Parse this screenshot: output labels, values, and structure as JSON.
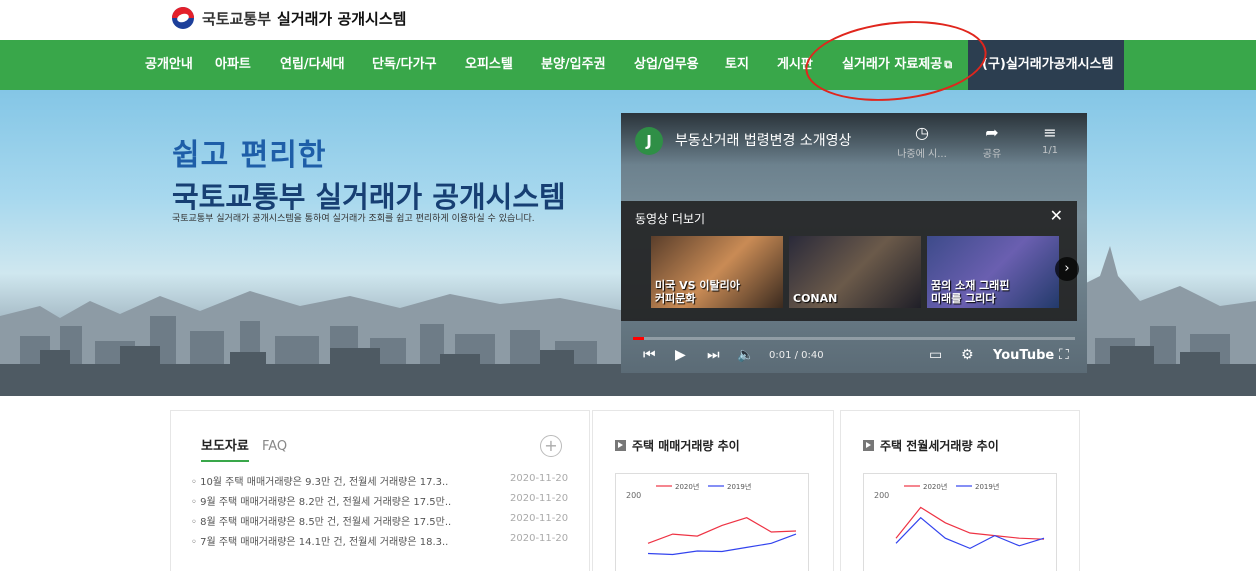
{
  "header": {
    "org_name": "국토교통부",
    "system_name": "실거래가 공개시스템"
  },
  "nav": {
    "items": [
      "공개안내",
      "아파트",
      "연립/다세대",
      "단독/다가구",
      "오피스텔",
      "분양/입주권",
      "상업/업무용",
      "토지",
      "게시판",
      "실거래가 자료제공"
    ],
    "old_system": "(구)실거래가공개시스템"
  },
  "banner": {
    "line1": "쉽고 편리한",
    "line2": "국토교통부 실거래가 공개시스템",
    "description": "국토교통부 실거래가 공개시스템을 통하여 실거래가 조회를 쉽고 편리하게 이용하실 수 있습니다."
  },
  "video": {
    "channel_initial": "J",
    "title": "부동산거래 법령변경 소개영상",
    "watch_later": "나중에 시...",
    "share": "공유",
    "playlist_count": "1/1",
    "more_videos": "동영상 더보기",
    "thumbs": [
      {
        "caption_line1": "미국 VS 이탈리아",
        "caption_line2": "커피문화"
      },
      {
        "caption_line1": "",
        "caption_line2": "CONAN"
      },
      {
        "caption_line1": "꿈의 소재 그래핀",
        "caption_line2": "미래를 그리다"
      }
    ],
    "time": "0:01 / 0:40",
    "progress": 0.025,
    "brand": "YouTube"
  },
  "news": {
    "tab_active": "보도자료",
    "tab_inactive": "FAQ",
    "items": [
      {
        "title": "10월 주택 매매거래량은 9.3만 건, 전월세 거래량은 17.3..",
        "date": "2020-11-20"
      },
      {
        "title": "9월 주택 매매거래량은 8.2만 건, 전월세 거래량은 17.5만..",
        "date": "2020-11-20"
      },
      {
        "title": "8월 주택 매매거래량은 8.5만 건, 전월세 거래량은 17.5만..",
        "date": "2020-11-20"
      },
      {
        "title": "7월 주택 매매거래량은 14.1만 건, 전월세 거래량은 18.3..",
        "date": "2020-11-20"
      }
    ]
  },
  "charts": {
    "sale_title": "주택 매매거래량 추이",
    "rent_title": "주택 전월세거래량 추이"
  },
  "chart_data": [
    {
      "type": "line",
      "title": "주택 매매거래량 추이",
      "y_tick": "200",
      "series": [
        {
          "name": "2020년",
          "color": "#ee3344",
          "values": [
            60,
            78,
            74,
            95,
            110,
            82,
            84
          ]
        },
        {
          "name": "2019년",
          "color": "#3344ee",
          "values": [
            40,
            38,
            45,
            44,
            52,
            60,
            78
          ]
        }
      ]
    },
    {
      "type": "line",
      "title": "주택 전월세거래량 추이",
      "y_tick": "200",
      "series": [
        {
          "name": "2020년",
          "color": "#ee3344",
          "values": [
            70,
            130,
            100,
            80,
            75,
            70,
            68
          ]
        },
        {
          "name": "2019년",
          "color": "#3344ee",
          "values": [
            60,
            110,
            70,
            50,
            75,
            55,
            70
          ]
        }
      ]
    }
  ]
}
